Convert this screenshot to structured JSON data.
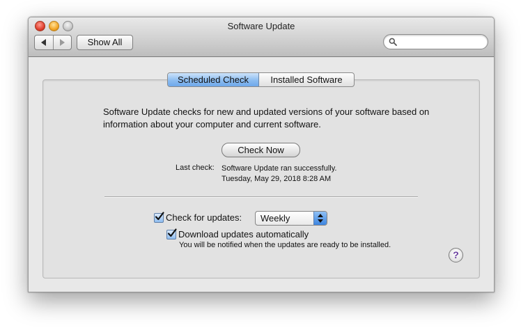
{
  "window": {
    "title": "Software Update"
  },
  "toolbar": {
    "show_all_label": "Show All",
    "search_placeholder": "",
    "search_icon": "search-icon"
  },
  "tabs": [
    {
      "label": "Scheduled Check",
      "selected": true
    },
    {
      "label": "Installed Software",
      "selected": false
    }
  ],
  "main": {
    "description": "Software Update checks for new and updated versions of your software based on information about your computer and current software.",
    "check_now_label": "Check Now",
    "last_check_label": "Last check:",
    "last_check_line1": "Software Update ran successfully.",
    "last_check_line2": "Tuesday, May 29, 2018 8:28 AM",
    "check_for_updates_label": "Check for updates:",
    "check_for_updates_checked": true,
    "frequency_value": "Weekly",
    "download_label": "Download updates automatically",
    "download_checked": true,
    "download_note": "You will be notified when the updates are ready to be installed.",
    "help_label": "?"
  },
  "colors": {
    "accent": "#6ea8ea",
    "window_bg": "#e8e8e8",
    "help_mark": "#6b3fa0"
  }
}
